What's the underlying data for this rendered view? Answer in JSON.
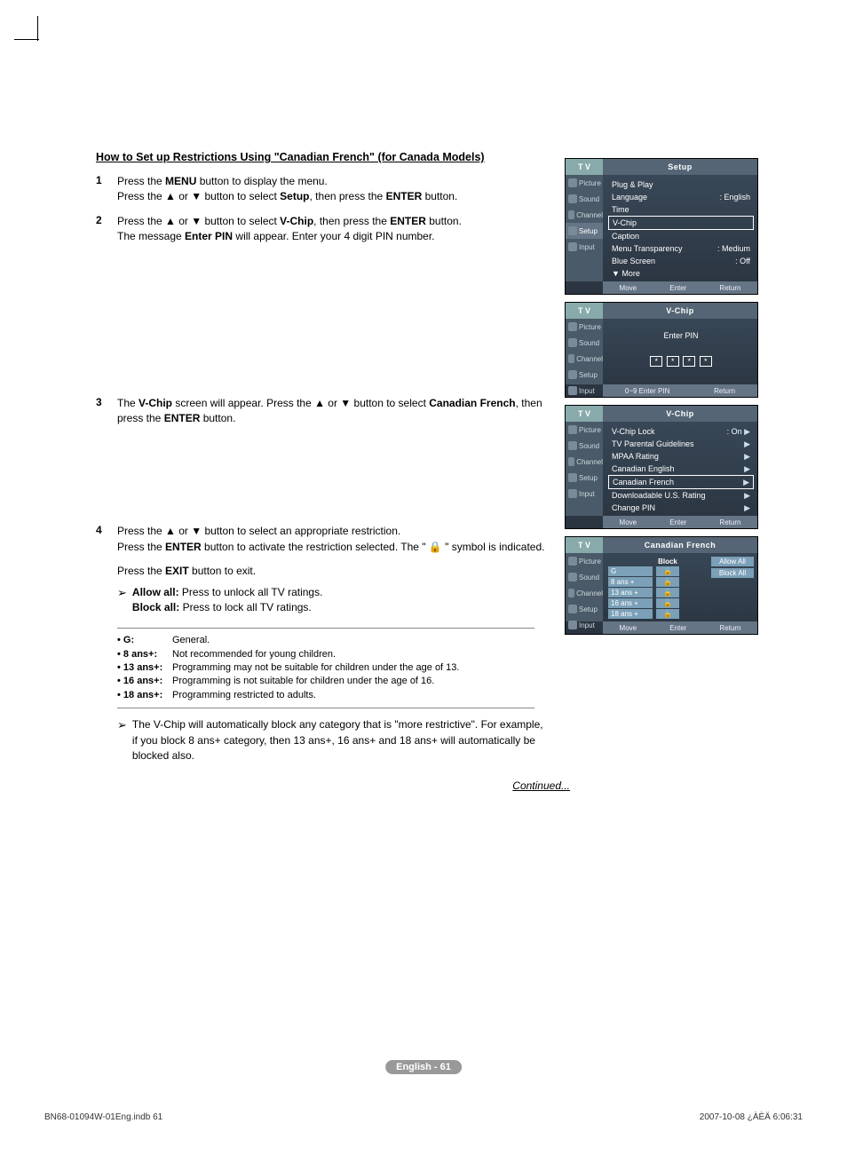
{
  "heading": "How to Set up Restrictions Using \"Canadian French\" (for Canada Models)",
  "steps": {
    "s1_num": "1",
    "s1_a": "Press the ",
    "s1_b": "MENU",
    "s1_c": " button to display the menu.",
    "s1_d": "Press the ▲ or ▼ button to select ",
    "s1_e": "Setup",
    "s1_f": ", then press the ",
    "s1_g": "ENTER",
    "s1_h": " button.",
    "s2_num": "2",
    "s2_a": "Press the ▲ or ▼ button to select ",
    "s2_b": "V-Chip",
    "s2_c": ", then press the ",
    "s2_d": "ENTER",
    "s2_e": " button.",
    "s2_f": "The message ",
    "s2_g": "Enter PIN",
    "s2_h": " will appear. Enter your 4 digit PIN number.",
    "s3_num": "3",
    "s3_a": "The ",
    "s3_b": "V-Chip",
    "s3_c": " screen will appear. Press the ▲ or ▼ button to select ",
    "s3_d": "Canadian French",
    "s3_e": ", then press the ",
    "s3_f": "ENTER",
    "s3_g": " button.",
    "s4_num": "4",
    "s4_a": "Press the ▲ or ▼ button to select an appropriate restriction.",
    "s4_b": "Press the ",
    "s4_c": "ENTER",
    "s4_d": " button to activate the restriction selected. The \" 🔒 \" symbol is indicated.",
    "s4_e": "Press the ",
    "s4_f": "EXIT",
    "s4_g": " button to exit.",
    "allow_lbl": "Allow all:",
    "allow_txt": " Press to unlock all TV ratings.",
    "block_lbl": "Block all:",
    "block_txt": " Press to lock all TV ratings."
  },
  "ratings": [
    {
      "k": "• G:",
      "v": "General."
    },
    {
      "k": "• 8 ans+:",
      "v": "Not recommended for young children."
    },
    {
      "k": "• 13 ans+:",
      "v": "Programming may not be suitable for children under the age of 13."
    },
    {
      "k": "• 16 ans+:",
      "v": "Programming is not suitable for children under the age of 16."
    },
    {
      "k": "• 18 ans+:",
      "v": "Programming restricted to adults."
    }
  ],
  "note": "The V-Chip will automatically block any category that is \"more restrictive\". For example, if you block 8 ans+ category, then 13 ans+, 16 ans+ and 18 ans+ will automatically be blocked also.",
  "continued": "Continued...",
  "osd": {
    "side": [
      "Picture",
      "Sound",
      "Channel",
      "Setup",
      "Input"
    ],
    "setup": {
      "title": "Setup",
      "rows": [
        {
          "l": "Plug & Play",
          "r": ""
        },
        {
          "l": "Language",
          "r": ": English"
        },
        {
          "l": "Time",
          "r": ""
        },
        {
          "l": "V-Chip",
          "r": "",
          "boxed": true
        },
        {
          "l": "Caption",
          "r": ""
        },
        {
          "l": "Menu Transparency",
          "r": ": Medium"
        },
        {
          "l": "Blue Screen",
          "r": ": Off"
        },
        {
          "l": "▼ More",
          "r": ""
        }
      ],
      "foot": [
        "Move",
        "Enter",
        "Return"
      ]
    },
    "pin": {
      "title": "V-Chip",
      "label": "Enter PIN",
      "mask": "*",
      "foot": [
        "0~9 Enter PIN",
        "Return"
      ]
    },
    "vchip": {
      "title": "V-Chip",
      "rows": [
        {
          "l": "V-Chip Lock",
          "r": ": On",
          "a": "▶"
        },
        {
          "l": "TV Parental Guidelines",
          "r": "",
          "a": "▶"
        },
        {
          "l": "MPAA Rating",
          "r": "",
          "a": "▶"
        },
        {
          "l": "Canadian English",
          "r": "",
          "a": "▶"
        },
        {
          "l": "Canadian French",
          "r": "",
          "a": "▶",
          "boxed": true
        },
        {
          "l": "Downloadable U.S. Rating",
          "r": "",
          "a": "▶"
        },
        {
          "l": "Change PIN",
          "r": "",
          "a": "▶"
        }
      ],
      "foot": [
        "Move",
        "Enter",
        "Return"
      ]
    },
    "cf": {
      "title": "Canadian French",
      "block": "Block",
      "levels": [
        "G",
        "8 ans +",
        "13 ans +",
        "16 ans +",
        "18 ans +"
      ],
      "allow": "Allow All",
      "blockall": "Block All",
      "foot": [
        "Move",
        "Enter",
        "Return"
      ]
    },
    "tv": "T V"
  },
  "footer": {
    "badge": "English - 61",
    "left": "BN68-01094W-01Eng.indb   61",
    "right": "2007-10-08   ¿ÀÈÄ 6:06:31"
  }
}
